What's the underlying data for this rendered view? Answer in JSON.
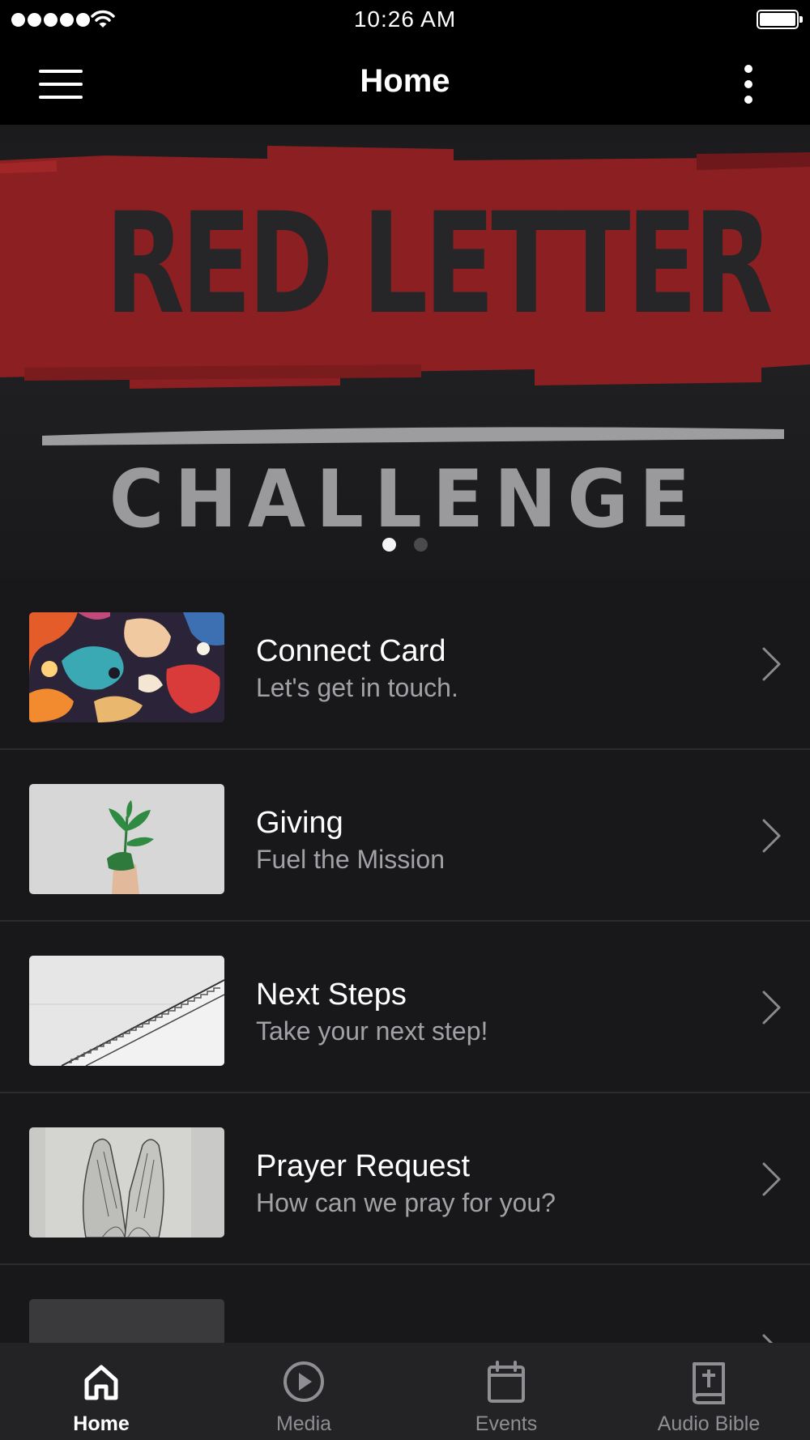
{
  "status_bar": {
    "time": "10:26 AM"
  },
  "nav": {
    "title": "Home",
    "menu_icon": "hamburger-menu-icon",
    "more_icon": "vertical-ellipsis-icon"
  },
  "hero": {
    "title": "RED LETTER",
    "subtitle": "CHALLENGE",
    "slide_count": 2,
    "active_slide": 1,
    "accent_color": "#8b1f22"
  },
  "list": {
    "items": [
      {
        "title": "Connect Card",
        "subtitle": "Let's get in touch.",
        "thumbnail": "abstract-color-swirl"
      },
      {
        "title": "Giving",
        "subtitle": "Fuel the Mission",
        "thumbnail": "hand-holding-plant"
      },
      {
        "title": "Next Steps",
        "subtitle": "Take your next step!",
        "thumbnail": "staircase"
      },
      {
        "title": "Prayer Request",
        "subtitle": "How can we pray for you?",
        "thumbnail": "praying-hands"
      },
      {
        "title": "",
        "subtitle": "",
        "thumbnail": "dark-placeholder"
      }
    ]
  },
  "tabs": [
    {
      "label": "Home",
      "icon": "home-icon",
      "active": true
    },
    {
      "label": "Media",
      "icon": "play-circle-icon",
      "active": false
    },
    {
      "label": "Events",
      "icon": "calendar-icon",
      "active": false
    },
    {
      "label": "Audio Bible",
      "icon": "bible-icon",
      "active": false
    }
  ],
  "colors": {
    "background": "#18181b",
    "bar": "#000000",
    "tab_bar": "#232326",
    "secondary_text": "#a2a2a6"
  }
}
